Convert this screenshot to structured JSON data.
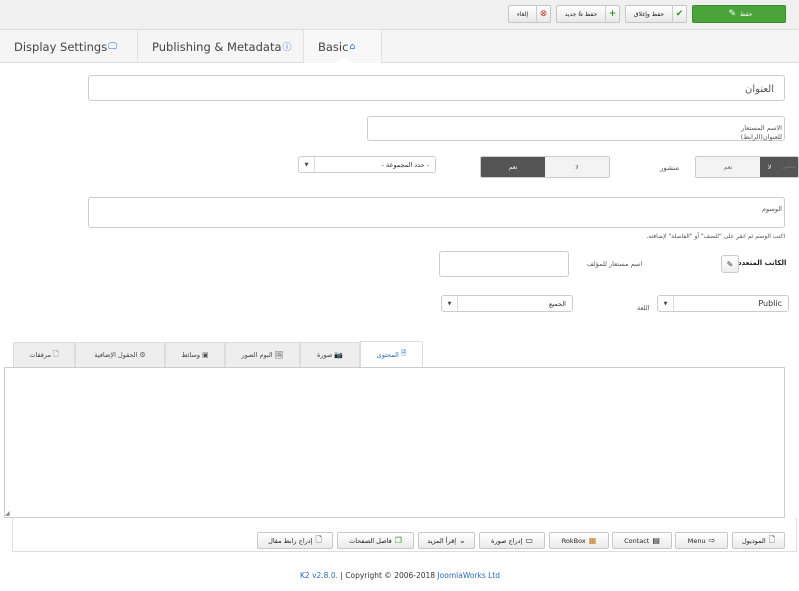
{
  "toolbar": {
    "save": "حفظ",
    "save_close": "حفظ وإغلاق",
    "save_new": "حفظ & جديد",
    "cancel": "إلغاء",
    "colors": {
      "save_bg": "#4aa43a"
    }
  },
  "tabs": [
    {
      "label": "Display Settings",
      "icon": "monitor-icon"
    },
    {
      "label": "Publishing & Metadata",
      "icon": "info-icon"
    },
    {
      "label": "Basic",
      "icon": "home-icon"
    }
  ],
  "form": {
    "title_placeholder": "العنوان",
    "alias_label_1": "الاسم المستعار",
    "alias_label_2": "للعنوان(الرابط)",
    "category_select": "- حدد المجموعة -",
    "featured_no": "لا",
    "featured_yes": "نعم",
    "published_label": "منشور",
    "published_yes": "نعم",
    "published_no": "لا",
    "published_hidden": "منشور",
    "tags_label": "الوسوم",
    "tags_hint": "اكتب الوسم ثم انقر على \"للضف\" أو \"الفاصلة\" لإضافته.",
    "author_label": "الكاتب",
    "author_value": "الكاتب",
    "author_full": "الكاتب المتعدد",
    "author_alias_label": "اسم مستعار للمؤلف",
    "access_value": "Public",
    "language_label": "اللغة",
    "language_value": "الجميع"
  },
  "editor_tabs": [
    {
      "label": "المحتوى",
      "icon": "document-icon"
    },
    {
      "label": "صورة",
      "icon": "camera-icon"
    },
    {
      "label": "البوم الصور",
      "icon": "gallery-icon"
    },
    {
      "label": "وسائط",
      "icon": "media-icon"
    },
    {
      "label": "الحقول الإضافية",
      "icon": "gear-icon"
    },
    {
      "label": "مرفقات",
      "icon": "file-icon"
    }
  ],
  "editor_buttons": [
    {
      "label": "الموديول",
      "icon": "file-plus-icon"
    },
    {
      "label": "Menu",
      "icon": "arrow-right-icon"
    },
    {
      "label": "Contact",
      "icon": "contact-icon"
    },
    {
      "label": "RokBox",
      "icon": "rokbox-icon"
    },
    {
      "label": "إدراج صورة",
      "icon": "image-icon"
    },
    {
      "label": "إقرأ المزيد",
      "icon": "chevron-down-icon"
    },
    {
      "label": "فاصل الصفحات",
      "icon": "copy-icon"
    },
    {
      "label": "إدراج رابط مقال",
      "icon": "file-link-icon"
    }
  ],
  "footer": {
    "version": "K2 v2.8.0.",
    "copyright": " | Copyright © 2006-2018 ",
    "company": "JoomlaWorks Ltd"
  }
}
